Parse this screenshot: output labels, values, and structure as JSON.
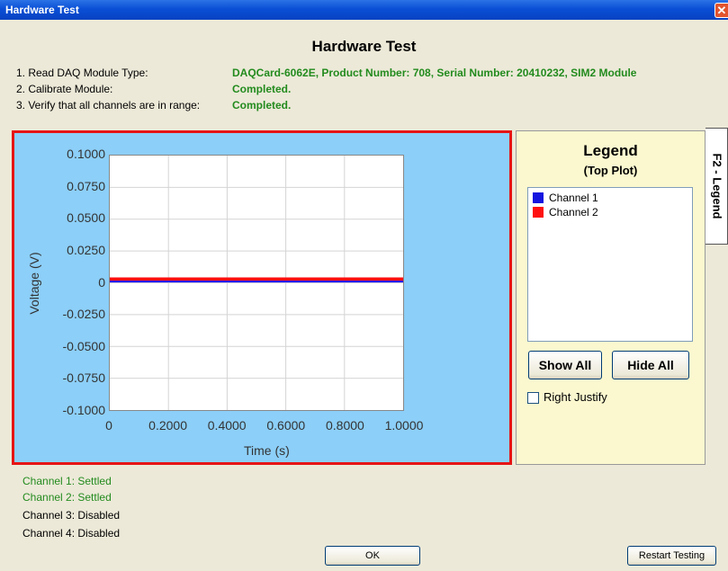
{
  "window": {
    "title": "Hardware Test",
    "close_glyph": "✕"
  },
  "heading": "Hardware Test",
  "steps": [
    {
      "label": "1.  Read DAQ Module Type:",
      "value": "DAQCard-6062E, Product Number: 708, Serial Number: 20410232, SIM2 Module"
    },
    {
      "label": "2.  Calibrate Module:",
      "value": "Completed."
    },
    {
      "label": "3.  Verify that all channels are in range:",
      "value": "Completed."
    }
  ],
  "chart_data": {
    "type": "line",
    "xlabel": "Time (s)",
    "ylabel": "Voltage (V)",
    "xlim": [
      0,
      1
    ],
    "ylim": [
      -0.1,
      0.1
    ],
    "x_ticks": [
      "0",
      "0.2000",
      "0.4000",
      "0.6000",
      "0.8000",
      "1.0000"
    ],
    "y_ticks": [
      "0.1000",
      "0.0750",
      "0.0500",
      "0.0250",
      "0",
      "-0.0250",
      "-0.0500",
      "-0.0750",
      "-0.1000"
    ],
    "grid": true,
    "series": [
      {
        "name": "Channel 1",
        "color": "#1a1aff",
        "x": [
          0,
          1
        ],
        "y": [
          0.001,
          0.001
        ]
      },
      {
        "name": "Channel 2",
        "color": "#ff1010",
        "x": [
          0,
          1
        ],
        "y": [
          0.0025,
          0.0025
        ]
      }
    ]
  },
  "legend": {
    "title": "Legend",
    "subtitle": "(Top Plot)",
    "tab_label": "F2 - Legend",
    "items": [
      {
        "name": "Channel 1",
        "color": "#1515e0"
      },
      {
        "name": "Channel 2",
        "color": "#ff1010"
      }
    ],
    "show_all": "Show All",
    "hide_all": "Hide All",
    "right_justify": "Right Justify"
  },
  "status": [
    {
      "text": "Channel 1: Settled",
      "color": "#238b1e"
    },
    {
      "text": "Channel 2: Settled",
      "color": "#238b1e"
    },
    {
      "text": "Channel 3: Disabled",
      "color": "#000000"
    },
    {
      "text": "Channel 4: Disabled",
      "color": "#000000"
    }
  ],
  "buttons": {
    "ok": "OK",
    "restart": "Restart Testing"
  }
}
